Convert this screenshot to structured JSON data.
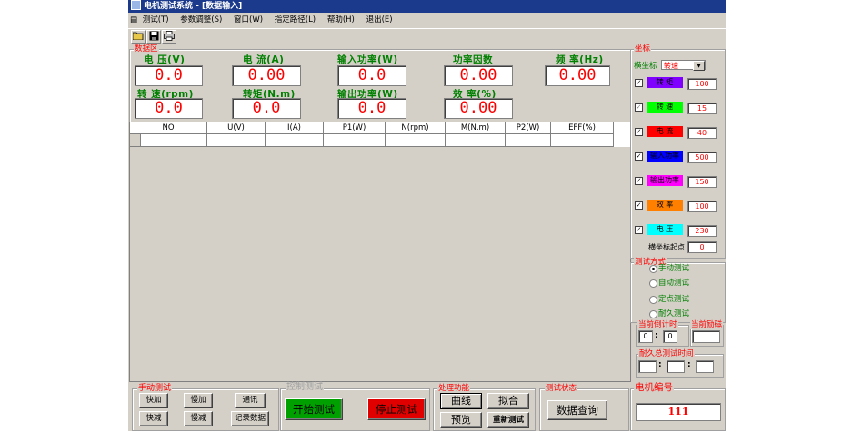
{
  "window": {
    "title": "电机测试系统 - [数据输入]"
  },
  "menu": [
    {
      "label": "测试(T)"
    },
    {
      "label": "参数调整(S)"
    },
    {
      "label": "窗口(W)"
    },
    {
      "label": "指定路径(L)"
    },
    {
      "label": "帮助(H)"
    },
    {
      "label": "退出(E)"
    }
  ],
  "data_area": {
    "title": "数据区",
    "fields": [
      {
        "label": "电 压(V)",
        "value": "0.0"
      },
      {
        "label": "电 流(A)",
        "value": "0.00"
      },
      {
        "label": "输入功率(W)",
        "value": "0.0"
      },
      {
        "label": "功率因数",
        "value": "0.00"
      },
      {
        "label": "频 率(Hz)",
        "value": "0.00"
      },
      {
        "label": "转 速(rpm)",
        "value": "0.0"
      },
      {
        "label": "转矩(N.m)",
        "value": "0.0"
      },
      {
        "label": "输出功率(W)",
        "value": "0.0"
      },
      {
        "label": "效 率(%)",
        "value": "0.00"
      }
    ]
  },
  "table": {
    "columns": [
      "NO",
      "U(V)",
      "I(A)",
      "P1(W)",
      "N(rpm)",
      "M(N.m)",
      "P2(W)",
      "EFF(%)"
    ]
  },
  "coords": {
    "title": "坐标",
    "axis_label": "横坐标",
    "axis_value": "转速",
    "items": [
      {
        "label": "转 矩",
        "color": "#8000ff",
        "value": "100",
        "checked": true
      },
      {
        "label": "转 速",
        "color": "#00ff00",
        "value": "15",
        "checked": true
      },
      {
        "label": "电 流",
        "color": "#ff0000",
        "value": "40",
        "checked": true
      },
      {
        "label": "输入功率",
        "color": "#0000ff",
        "value": "500",
        "checked": true
      },
      {
        "label": "输出功率",
        "color": "#ff00ff",
        "value": "150",
        "checked": true
      },
      {
        "label": "效 率",
        "color": "#ff8000",
        "value": "100",
        "checked": true
      },
      {
        "label": "电 压",
        "color": "#00ffff",
        "value": "230",
        "checked": true
      }
    ],
    "origin_label": "横坐标起点",
    "origin_value": "0"
  },
  "test_mode": {
    "title": "测试方式",
    "options": [
      "手动测试",
      "自动测试",
      "定点测试",
      "耐久测试"
    ],
    "countdown_label": "当前倒计时",
    "countdown_min": "0",
    "countdown_sec": "0",
    "excite_label": "当前励磁",
    "excite_value": "",
    "endurance_label": "耐久总测试时间"
  },
  "manual": {
    "title": "手动测试",
    "buttons": [
      "快加",
      "慢加",
      "通讯",
      "快减",
      "慢减",
      "记录数据"
    ]
  },
  "control": {
    "title": "控制测试",
    "start": "开始测试",
    "stop": "停止测试"
  },
  "process": {
    "title": "处理功能",
    "curve": "曲线",
    "fit": "拟合",
    "preview": "预览",
    "retest": "重新测试"
  },
  "status": {
    "title": "测试状态",
    "query": "数据查询"
  },
  "motor": {
    "title": "电机编号",
    "value": "111"
  }
}
